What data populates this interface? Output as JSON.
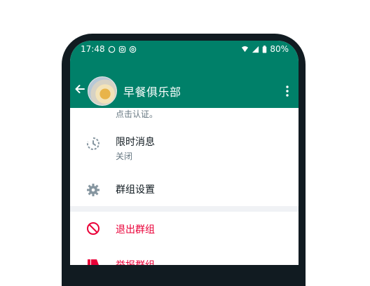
{
  "status_bar": {
    "time": "17:48",
    "battery": "80%",
    "icons": [
      "whatsapp-icon",
      "instagram-icon",
      "at-icon",
      "wifi-icon",
      "signal-icon",
      "battery-icon"
    ]
  },
  "app_bar": {
    "title": "早餐俱乐部",
    "back_icon": "arrow-left-icon",
    "menu_icon": "more-vertical-icon"
  },
  "content": {
    "partial_text": "点击认证。",
    "items": [
      {
        "title": "限时消息",
        "subtitle": "关闭",
        "icon": "disappearing-timer-icon"
      },
      {
        "title": "群组设置",
        "icon": "gear-icon"
      }
    ],
    "actions": [
      {
        "title": "退出群组",
        "icon": "exit-circle-icon"
      },
      {
        "title": "举报群组",
        "icon": "thumb-down-icon"
      }
    ]
  },
  "colors": {
    "header": "#008069",
    "danger": "#ea0038",
    "text_primary": "#111b21",
    "text_secondary": "#667781"
  }
}
